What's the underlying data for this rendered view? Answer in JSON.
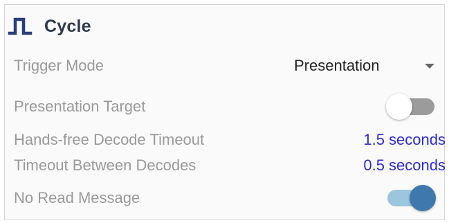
{
  "section": {
    "title": "Cycle",
    "icon": "pulse-wave-icon"
  },
  "colors": {
    "label": "#9a9a9a",
    "value_link": "#2b2bd9",
    "toggle_on_knob": "#3e78ad",
    "toggle_on_track": "#9cc6de",
    "toggle_off_track": "#9b9b9b"
  },
  "settings": {
    "trigger_mode": {
      "label": "Trigger Mode",
      "value": "Presentation"
    },
    "presentation_target": {
      "label": "Presentation Target",
      "enabled": false
    },
    "hands_free_timeout": {
      "label": "Hands-free Decode Timeout",
      "value": "1.5 seconds"
    },
    "timeout_between": {
      "label": "Timeout Between Decodes",
      "value": "0.5 seconds"
    },
    "no_read_message": {
      "label": "No Read Message",
      "enabled": true
    }
  }
}
